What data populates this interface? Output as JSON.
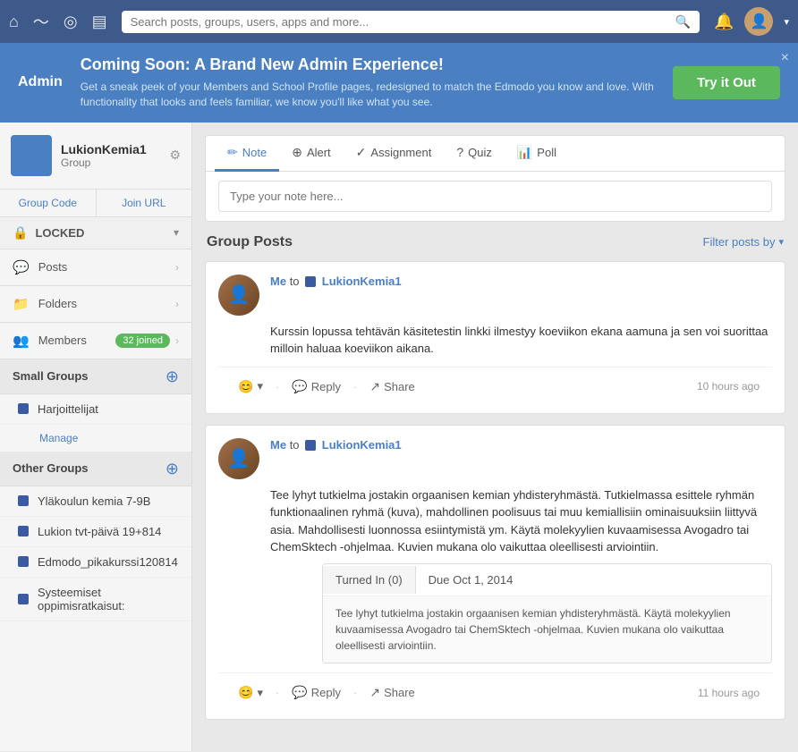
{
  "topnav": {
    "search_placeholder": "Search posts, groups, users, apps and more...",
    "dropdown_arrow": "▾"
  },
  "banner": {
    "admin_label": "Admin",
    "title": "Coming Soon: A Brand New Admin Experience!",
    "description": "Get a sneak peek of your Members and School Profile pages, redesigned to match the Edmodo you know and love. With functionality that looks and feels familiar, we know you'll like what you see.",
    "try_button": "Try it Out",
    "close": "×"
  },
  "sidebar": {
    "group_name": "LukionKemia1",
    "group_type": "Group",
    "tab_group_code": "Group Code",
    "tab_join_url": "Join URL",
    "locked_label": "LOCKED",
    "posts_label": "Posts",
    "folders_label": "Folders",
    "members_label": "Members",
    "members_count": "32 joined",
    "small_groups_label": "Small Groups",
    "harjoittelijat_label": "Harjoittelijat",
    "manage_label": "Manage",
    "other_groups_label": "Other Groups",
    "other_groups": [
      {
        "label": "Yläkoulun kemia 7-9B",
        "color": "#3a5ba0"
      },
      {
        "label": "Lukion tvt-päivä 19+814",
        "color": "#3a5ba0"
      },
      {
        "label": "Edmodo_pikakurssi120814",
        "color": "#3a5ba0"
      },
      {
        "label": "Systeemiset oppimisratkaisut:",
        "color": "#3a5ba0"
      }
    ]
  },
  "composer": {
    "tabs": [
      {
        "label": "Note",
        "icon": "✏"
      },
      {
        "label": "Alert",
        "icon": "⊕"
      },
      {
        "label": "Assignment",
        "icon": "✓"
      },
      {
        "label": "Quiz",
        "icon": "?"
      },
      {
        "label": "Poll",
        "icon": "📊"
      }
    ],
    "placeholder": "Type your note here..."
  },
  "group_posts": {
    "title": "Group Posts",
    "filter_label": "Filter posts by"
  },
  "posts": [
    {
      "id": "post1",
      "author": "Me",
      "to_label": "to",
      "group": "LukionKemia1",
      "body": "Kurssin lopussa tehtävän käsitetestin linkki ilmestyy koeviikon ekana aamuna ja sen voi suorittaa milloin haluaa koeviikon aikana.",
      "time": "10 hours ago",
      "reply_label": "Reply",
      "share_label": "Share",
      "has_assignment": false
    },
    {
      "id": "post2",
      "author": "Me",
      "to_label": "to",
      "group": "LukionKemia1",
      "body": "Tee lyhyt tutkielma jostakin orgaanisen kemian yhdisteryhmästä. Tutkielmassa esittele ryhmän funktionaalinen ryhmä (kuva), mahdollinen poolisuus tai muu kemiallisiin ominaisuuksiin liittyvä asia. Mahdollisesti luonnossa esiintymistä ym. Käytä molekyylien kuvaamisessa Avogadro tai ChemSktech -ohjelmaa. Kuvien mukana olo vaikuttaa oleellisesti arviointiin.",
      "time": "11 hours ago",
      "reply_label": "Reply",
      "share_label": "Share",
      "has_assignment": true,
      "assignment": {
        "turned_in_label": "Turned In (0)",
        "due_label": "Due Oct 1, 2014",
        "description": "Tee lyhyt tutkielma jostakin orgaanisen kemian yhdisteryhmästä. Käytä molekyylien kuvaamisessa Avogadro tai ChemSktech -ohjelmaa. Kuvien mukana olo vaikuttaa oleellisesti arviointiin."
      }
    }
  ]
}
